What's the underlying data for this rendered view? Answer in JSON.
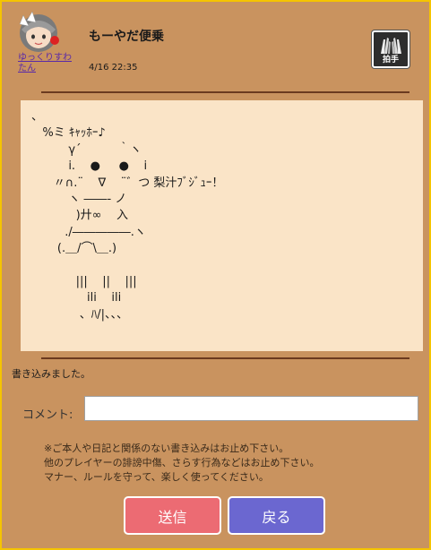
{
  "post": {
    "username": "ゆっくりすわたん",
    "title": "もーやだ便乗",
    "date": "4/16 22:35"
  },
  "clap_button": {
    "label": "拍手",
    "icon": "clap-hands-icon"
  },
  "art_lines": [
    "、",
    "   %ミ ｷｬｯﾎｰ♪",
    "          γ´          ｀ヽ",
    "          i.    ●     ●    i",
    "      〃∩.¨    ∇    ¨゛つ 梨汁ﾌﾞｼﾞｭｰ！",
    "          ヽ ――- ノ",
    "            )廾∞    入",
    "         ./―――――.ヽ",
    "       (.＿/⌒\\＿.)",
    "",
    "            |||    ||    |||",
    "               ili    ili",
    "             、ﾊ/|、、、"
  ],
  "status": {
    "posted_message": "書き込みました。"
  },
  "comment": {
    "label": "コメント:",
    "value": "",
    "placeholder": ""
  },
  "notice_lines": [
    "※ご本人や日記と関係のない書き込みはお止め下さい。",
    "他のプレイヤーの誹謗中傷、さらす行為などはお止め下さい。",
    "マナー、ルールを守って、楽しく使ってください。"
  ],
  "buttons": {
    "send": "送信",
    "back": "戻る"
  },
  "colors": {
    "background": "#c9935f",
    "border": "#f5c400",
    "art_bg": "#fae4c7",
    "send_button": "#ec6b73",
    "back_button": "#6b67d0"
  }
}
